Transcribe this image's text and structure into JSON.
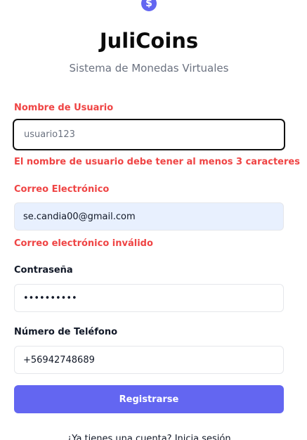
{
  "header": {
    "logo_icon": "$",
    "title": "JuliCoins",
    "subtitle": "Sistema de Monedas Virtuales"
  },
  "form": {
    "username": {
      "label": "Nombre de Usuario",
      "placeholder": "usuario123",
      "value": "",
      "error": "El nombre de usuario debe tener al menos 3 caracteres"
    },
    "email": {
      "label": "Correo Electrónico",
      "value": "se.candia00@gmail.com",
      "error": "Correo electrónico inválido"
    },
    "password": {
      "label": "Contraseña",
      "value": "••••••••••"
    },
    "phone": {
      "label": "Número de Teléfono",
      "value": "+56942748689"
    },
    "submit_label": "Registrarse"
  },
  "footer": {
    "prompt": "¿Ya tienes una cuenta? ",
    "login_link": "Inicia sesión"
  },
  "colors": {
    "accent": "#6366f1",
    "error": "#ef4444",
    "autofill_bg": "#e8f0fe"
  }
}
